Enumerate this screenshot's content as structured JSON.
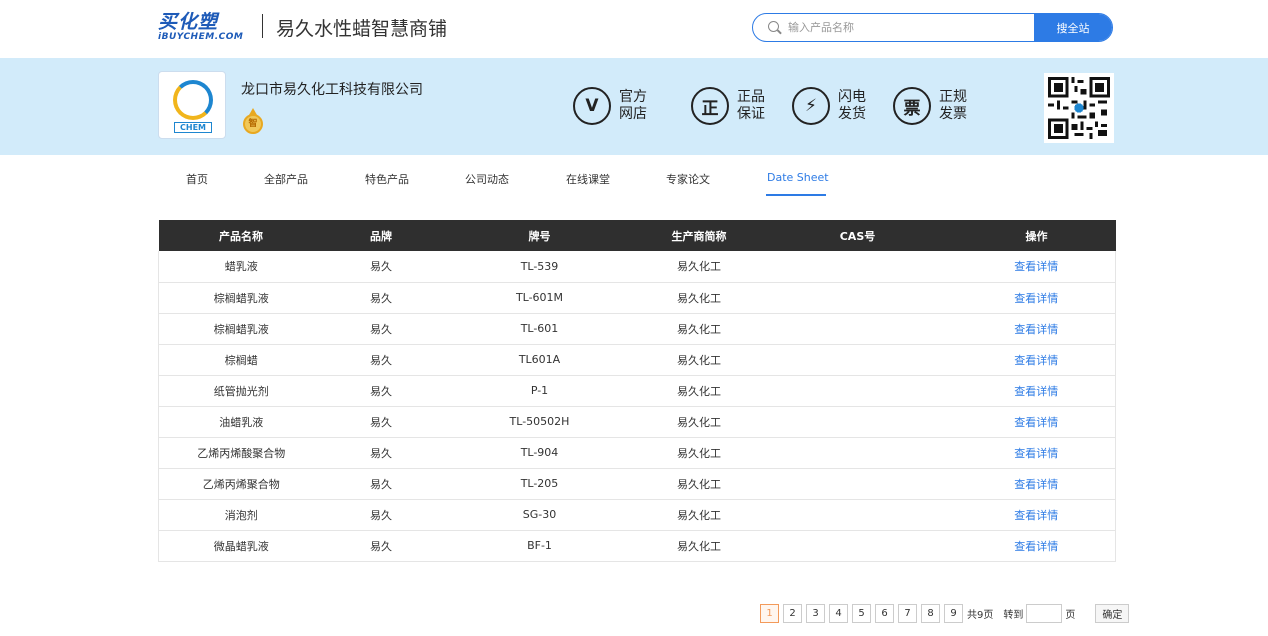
{
  "header": {
    "logo_line1": "买化塑",
    "logo_line2": "iBUYCHEM.COM",
    "shop_title": "易久水性蜡智慧商铺",
    "search_placeholder": "输入产品名称",
    "search_button": "搜全站"
  },
  "banner": {
    "company_name": "龙口市易久化工科技有限公司",
    "logo_text": "CHEM",
    "medal_text": "智",
    "badges": [
      {
        "icon": "V",
        "icon_name": "check-v-icon",
        "line1": "官方",
        "line2": "网店"
      },
      {
        "icon": "正",
        "icon_name": "genuine-icon",
        "line1": "正品",
        "line2": "保证"
      },
      {
        "icon": "⚡",
        "icon_name": "lightning-icon",
        "line1": "闪电",
        "line2": "发货"
      },
      {
        "icon": "票",
        "icon_name": "invoice-icon",
        "line1": "正规",
        "line2": "发票"
      }
    ]
  },
  "nav": {
    "items": [
      "首页",
      "全部产品",
      "特色产品",
      "公司动态",
      "在线课堂",
      "专家论文",
      "Date Sheet"
    ],
    "active_index": 6
  },
  "table": {
    "headers": [
      "产品名称",
      "品牌",
      "牌号",
      "生产商简称",
      "CAS号",
      "操作"
    ],
    "rows": [
      [
        "蜡乳液",
        "易久",
        "TL-539",
        "易久化工",
        "",
        "查看详情"
      ],
      [
        "棕榈蜡乳液",
        "易久",
        "TL-601M",
        "易久化工",
        "",
        "查看详情"
      ],
      [
        "棕榈蜡乳液",
        "易久",
        "TL-601",
        "易久化工",
        "",
        "查看详情"
      ],
      [
        "棕榈蜡",
        "易久",
        "TL601A",
        "易久化工",
        "",
        "查看详情"
      ],
      [
        "纸管抛光剂",
        "易久",
        "P-1",
        "易久化工",
        "",
        "查看详情"
      ],
      [
        "油蜡乳液",
        "易久",
        "TL-50502H",
        "易久化工",
        "",
        "查看详情"
      ],
      [
        "乙烯丙烯酸聚合物",
        "易久",
        "TL-904",
        "易久化工",
        "",
        "查看详情"
      ],
      [
        "乙烯丙烯聚合物",
        "易久",
        "TL-205",
        "易久化工",
        "",
        "查看详情"
      ],
      [
        "消泡剂",
        "易久",
        "SG-30",
        "易久化工",
        "",
        "查看详情"
      ],
      [
        "微晶蜡乳液",
        "易久",
        "BF-1",
        "易久化工",
        "",
        "查看详情"
      ]
    ]
  },
  "pager": {
    "pages": [
      "1",
      "2",
      "3",
      "4",
      "5",
      "6",
      "7",
      "8",
      "9"
    ],
    "current": 0,
    "total_text": "共9页",
    "goto_label": "转到",
    "page_unit": "页",
    "confirm": "确定"
  },
  "colors": {
    "accent": "#2d7be5",
    "banner_bg": "#d2ebfa",
    "table_header": "#2f2f2f",
    "pager_current": "#f39a5a"
  }
}
